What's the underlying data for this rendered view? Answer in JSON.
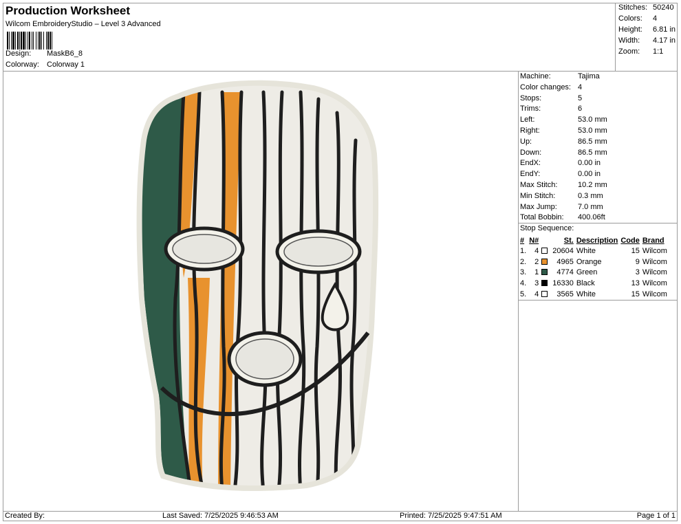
{
  "header": {
    "title": "Production Worksheet",
    "subtitle": "Wilcom EmbroideryStudio – Level 3 Advanced",
    "design_label": "Design:",
    "design_value": "MaskB6_8",
    "colorway_label": "Colorway:",
    "colorway_value": "Colorway 1"
  },
  "summary": {
    "stitches_label": "Stitches:",
    "stitches_value": "50240",
    "colors_label": "Colors:",
    "colors_value": "4",
    "height_label": "Height:",
    "height_value": "6.81 in",
    "width_label": "Width:",
    "width_value": "4.17 in",
    "zoom_label": "Zoom:",
    "zoom_value": "1:1"
  },
  "machine_info": [
    {
      "label": "Machine:",
      "value": "Tajima"
    },
    {
      "label": "Color changes:",
      "value": "4"
    },
    {
      "label": "Stops:",
      "value": "5"
    },
    {
      "label": "Trims:",
      "value": "6"
    },
    {
      "label": "Left:",
      "value": "53.0 mm"
    },
    {
      "label": "Right:",
      "value": "53.0 mm"
    },
    {
      "label": "Up:",
      "value": "86.5 mm"
    },
    {
      "label": "Down:",
      "value": "86.5 mm"
    },
    {
      "label": "EndX:",
      "value": "0.00 in"
    },
    {
      "label": "EndY:",
      "value": "0.00 in"
    },
    {
      "label": "Max Stitch:",
      "value": "10.2 mm"
    },
    {
      "label": "Min Stitch:",
      "value": "0.3 mm"
    },
    {
      "label": "Max Jump:",
      "value": "7.0 mm"
    },
    {
      "label": "Total Bobbin:",
      "value": "400.06ft"
    }
  ],
  "stop_sequence": {
    "title": "Stop Sequence:",
    "headers": {
      "num": "#",
      "needle": "N#",
      "stitches": "St.",
      "description": "Description",
      "code": "Code",
      "brand": "Brand"
    },
    "rows": [
      {
        "num": "1.",
        "needle": "4",
        "color": "#ffffff",
        "stitches": "20604",
        "description": "White",
        "code": "15",
        "brand": "Wilcom"
      },
      {
        "num": "2.",
        "needle": "2",
        "color": "#e8922e",
        "stitches": "4965",
        "description": "Orange",
        "code": "9",
        "brand": "Wilcom"
      },
      {
        "num": "3.",
        "needle": "1",
        "color": "#2e5a48",
        "stitches": "4774",
        "description": "Green",
        "code": "3",
        "brand": "Wilcom"
      },
      {
        "num": "4.",
        "needle": "3",
        "color": "#000000",
        "stitches": "16330",
        "description": "Black",
        "code": "13",
        "brand": "Wilcom"
      },
      {
        "num": "5.",
        "needle": "4",
        "color": "#ffffff",
        "stitches": "3565",
        "description": "White",
        "code": "15",
        "brand": "Wilcom"
      }
    ]
  },
  "footer": {
    "created_by": "Created By:",
    "last_saved": "Last Saved: 7/25/2025 9:46:53 AM",
    "printed": "Printed: 7/25/2025 9:47:51 AM",
    "page": "Page 1 of 1"
  },
  "colors": {
    "white_thread": "#f3f2ea",
    "orange_thread": "#e8922e",
    "green_thread": "#2e5a48",
    "black_thread": "#1e1e1e",
    "border": "#9a9a9a"
  }
}
